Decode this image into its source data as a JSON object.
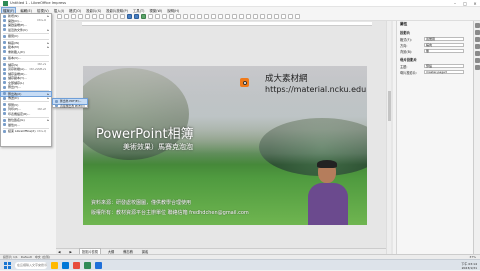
{
  "window": {
    "title": "Untitled 1 - LibreOffice Impress"
  },
  "menubar": [
    "檔案(F)",
    "編輯(E)",
    "檢視(V)",
    "插入(I)",
    "格式(O)",
    "投影片(S)",
    "投影片放映(P)",
    "工具(T)",
    "視窗(W)",
    "說明(H)"
  ],
  "file_menu": {
    "items": [
      {
        "label": "新增(N)",
        "shortcut": "",
        "arrow": "▸"
      },
      {
        "label": "開啟(O)…",
        "shortcut": "Ctrl+O",
        "arrow": ""
      },
      {
        "label": "開啟遠端(E)…",
        "shortcut": "",
        "arrow": ""
      },
      {
        "label": "最近的文件(U)",
        "shortcut": "",
        "arrow": "▸"
      },
      {
        "label": "關閉(C)",
        "shortcut": "",
        "arrow": ""
      },
      {
        "label": "精靈(W)",
        "shortcut": "",
        "arrow": "▸"
      },
      {
        "label": "範本(M)",
        "shortcut": "",
        "arrow": "▸"
      },
      {
        "label": "重新載入(D)",
        "shortcut": "",
        "arrow": ""
      },
      {
        "label": "版本(V)…",
        "shortcut": "",
        "arrow": ""
      },
      {
        "label": "儲存(S)",
        "shortcut": "Ctrl+S",
        "arrow": ""
      },
      {
        "label": "另存新檔(A)…",
        "shortcut": "Ctrl+Shift+S",
        "arrow": ""
      },
      {
        "label": "儲存遠端(R)…",
        "shortcut": "",
        "arrow": ""
      },
      {
        "label": "儲存副本(Y)…",
        "shortcut": "",
        "arrow": ""
      },
      {
        "label": "全部儲存(L)",
        "shortcut": "",
        "arrow": ""
      },
      {
        "label": "匯出(T)…",
        "shortcut": "",
        "arrow": ""
      },
      {
        "label": "匯出為(X)",
        "shortcut": "",
        "arrow": "▸"
      },
      {
        "label": "傳送(D)",
        "shortcut": "",
        "arrow": "▸"
      },
      {
        "label": "預覽(V)",
        "shortcut": "",
        "arrow": ""
      },
      {
        "label": "列印(P)…",
        "shortcut": "Ctrl+P",
        "arrow": ""
      },
      {
        "label": "印表機設定(R)…",
        "shortcut": "",
        "arrow": ""
      },
      {
        "label": "數位簽名(G)",
        "shortcut": "",
        "arrow": "▸"
      },
      {
        "label": "屬性(I)…",
        "shortcut": "",
        "arrow": ""
      },
      {
        "label": "結束 LibreOffice(X)",
        "shortcut": "Ctrl+Q",
        "arrow": ""
      }
    ],
    "highlighted_index": 15
  },
  "submenu": [
    "匯出為 PDF(E)…",
    "直接匯出為 PDF(D)"
  ],
  "slide": {
    "brand": "成大素材網",
    "url": "https://material.ncku.edu.tw",
    "title": "PowerPoint相簿",
    "subtitle": "美術效果）馬賽克泡泡",
    "line1": "資料來源：研發處校園圖，僅供教學合理使用",
    "line2": "版權所有：教材資源平台主辦單位 聯絡信箱 fredhdchen@gmail.com"
  },
  "sheet_tabs": [
    "投影片檢視",
    "大綱",
    "備忘稿",
    "講義"
  ],
  "statusbar": [
    "投影片 1/1",
    "Default",
    "中文 (台灣)",
    "37%"
  ],
  "right_panel": {
    "header": "屬性",
    "section_slide": "投影片",
    "rows": [
      {
        "label": "格式(F):",
        "value": "寬螢幕"
      },
      {
        "label": "方向:",
        "value": "橫向"
      },
      {
        "label": "背景(B):",
        "value": "無"
      }
    ],
    "section_master": "母片投影片",
    "master_rows": [
      {
        "label": "主題:",
        "value": "預設"
      },
      {
        "label": "母片投影片:",
        "value": "master-page3"
      }
    ]
  },
  "taskbar": {
    "search_placeholder": "在這裡輸入文字來搜尋",
    "time": "下午 03:14",
    "date": "2023/1/31"
  }
}
